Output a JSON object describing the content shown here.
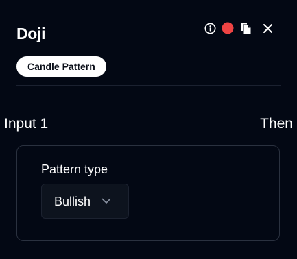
{
  "panel": {
    "title": "Doji",
    "badge": "Candle Pattern",
    "header_icons": [
      "info-icon",
      "record-dot-icon",
      "copy-icon",
      "close-icon"
    ],
    "status_dot_color": "#ef4444"
  },
  "connectors": {
    "input_label": "Input 1",
    "output_label": "Then"
  },
  "settings": {
    "pattern_type_label": "Pattern type",
    "pattern_type_value": "Bullish"
  }
}
